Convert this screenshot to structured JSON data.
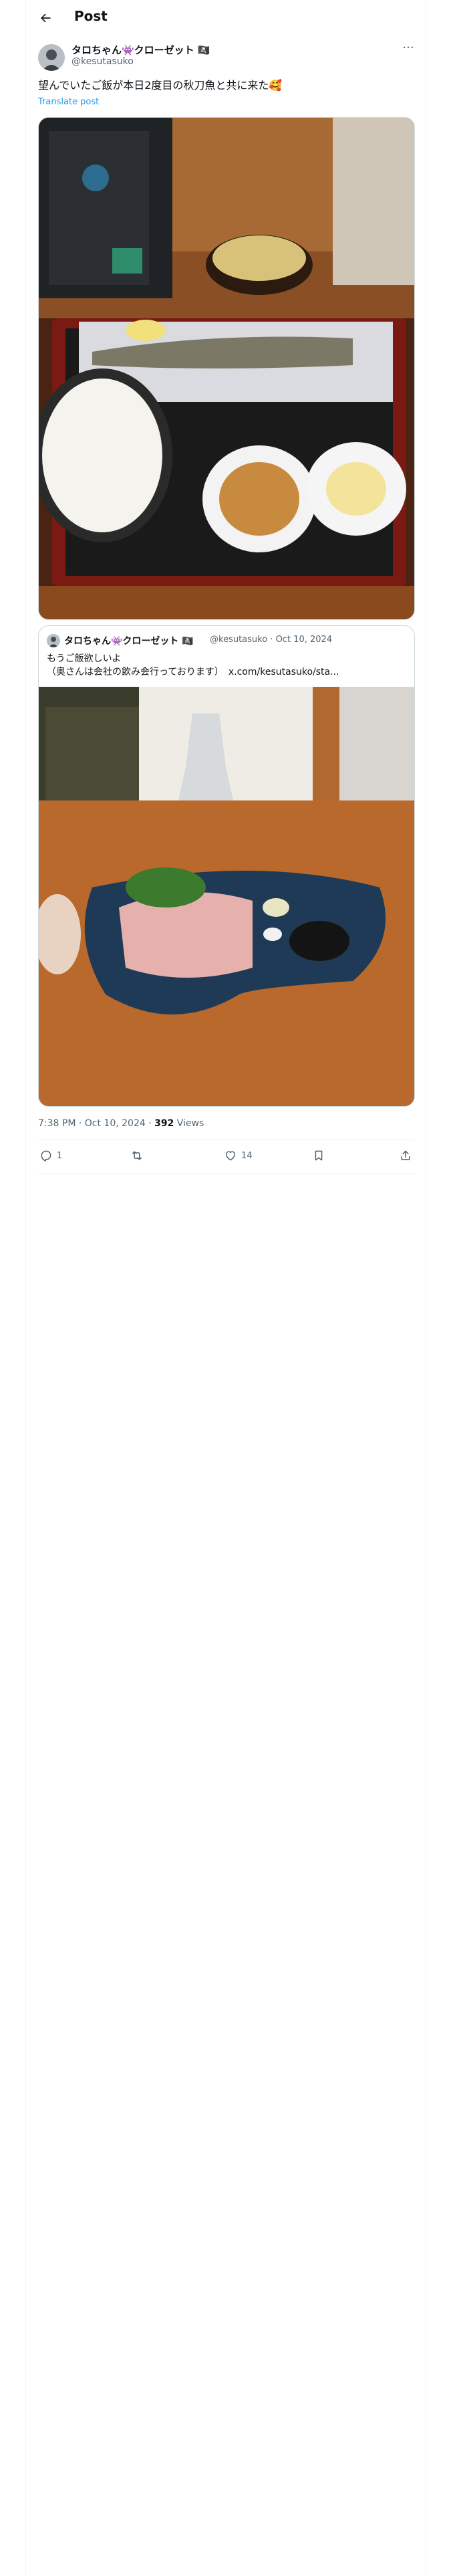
{
  "header": {
    "title": "Post"
  },
  "post": {
    "author_name": "タロちゃん👾クローゼット 🏴‍☠️",
    "author_handle": "@kesutasuko",
    "text": "望んでいたご飯が本日2度目の秋刀魚と共に来た🥰",
    "translate": "Translate post",
    "timestamp": "7:38 PM · Oct 10, 2024 · ",
    "views_count": "392",
    "views_label": " Views"
  },
  "quote": {
    "author_name": "タロちゃん👾クローゼット 🏴‍☠️",
    "meta": "@kesutasuko · Oct 10, 2024",
    "line1": "もうご飯欲しいよ",
    "line2": "（奥さんは会社の飲み会行っております）　x.com/kesutasuko/sta..."
  },
  "actions": {
    "replies": "1",
    "reposts": "",
    "likes": "14"
  },
  "icons": {
    "back": "back-arrow-icon",
    "more": "more-icon",
    "reply": "reply-icon",
    "repost": "repost-icon",
    "like": "like-icon",
    "bookmark": "bookmark-icon",
    "share": "share-icon"
  }
}
